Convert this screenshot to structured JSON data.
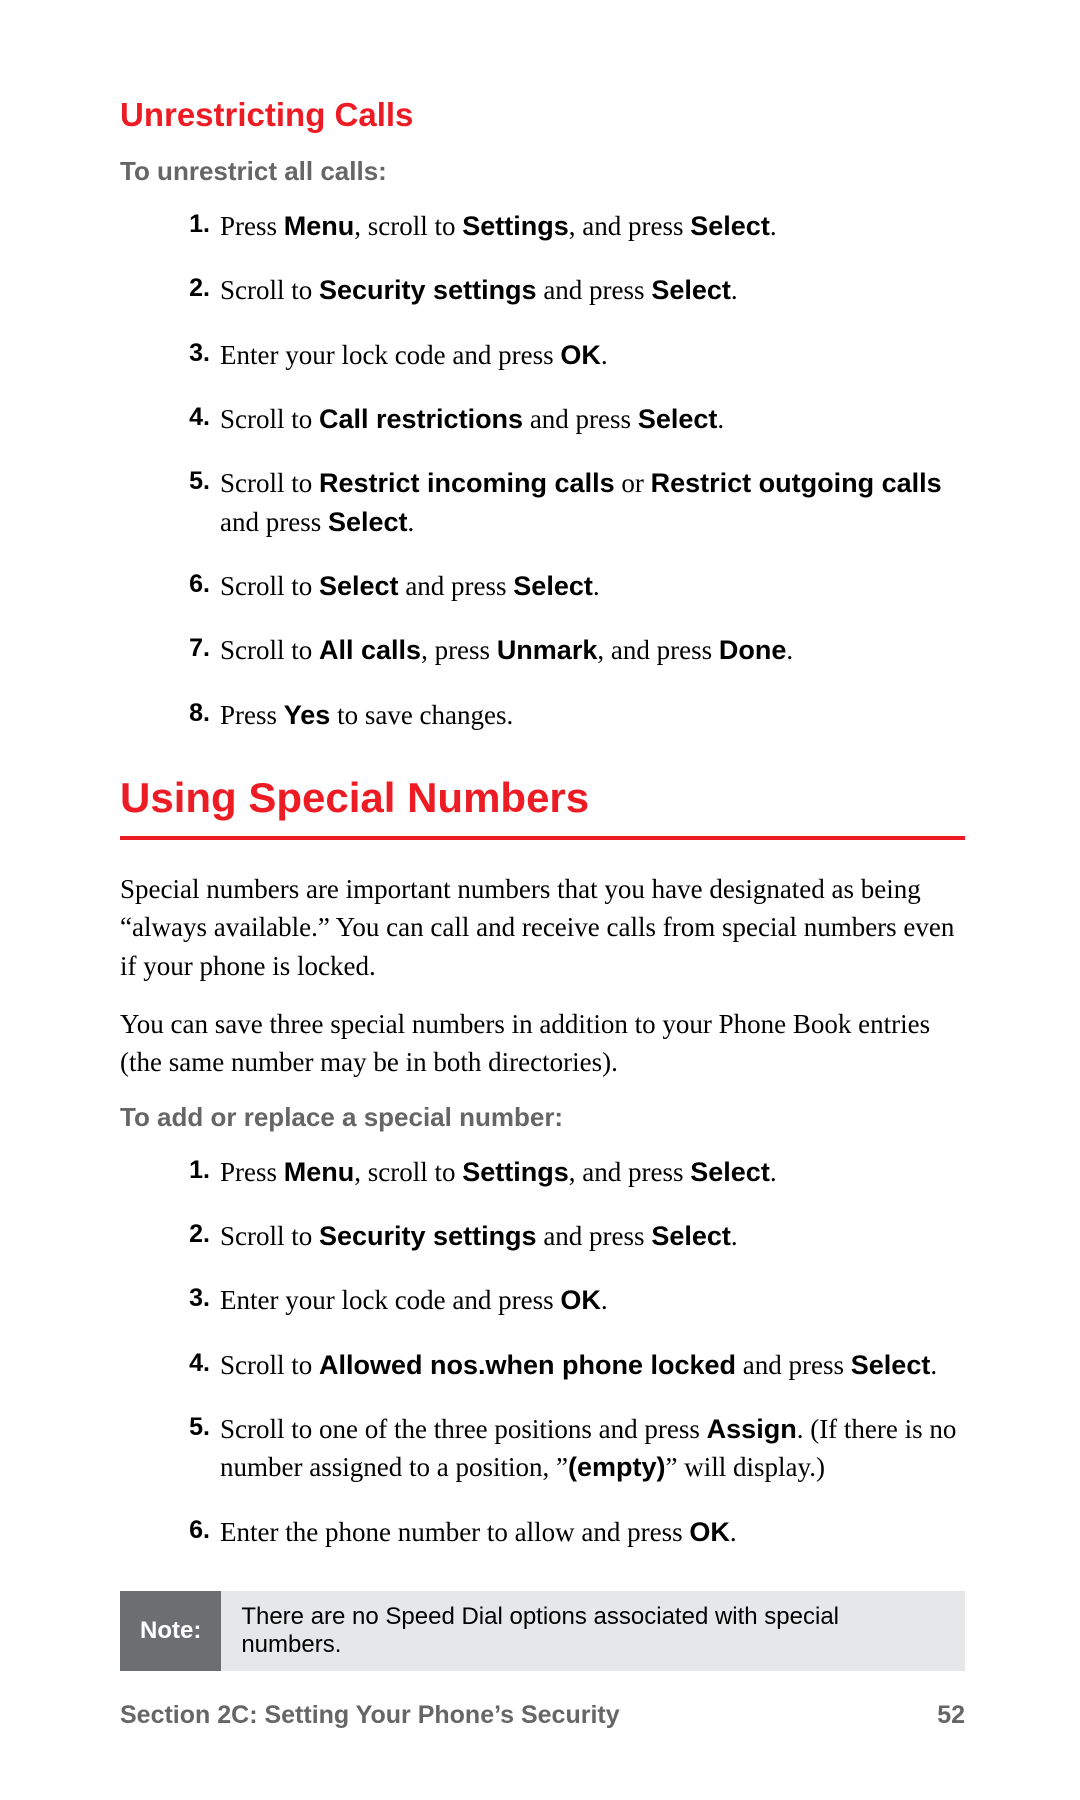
{
  "headings": {
    "unrestricting": "Unrestricting Calls",
    "using_special": "Using Special Numbers"
  },
  "leads": {
    "unrestrict_all": "To unrestrict all calls:",
    "add_special": "To add or replace a special number:"
  },
  "steps_unrestrict": [
    {
      "pre": "Press ",
      "b1": "Menu",
      "mid1": ", scroll to ",
      "b2": "Settings",
      "mid2": ", and press ",
      "b3": "Select",
      "post": "."
    },
    {
      "pre": "Scroll to ",
      "b1": "Security settings",
      "mid1": " and press ",
      "b2": "Select",
      "post": "."
    },
    {
      "pre": "Enter your lock code and press ",
      "b1": "OK",
      "post": "."
    },
    {
      "pre": "Scroll to ",
      "b1": "Call restrictions",
      "mid1": " and press ",
      "b2": "Select",
      "post": "."
    },
    {
      "pre": "Scroll to ",
      "b1": "Restrict incoming calls",
      "mid1": " or ",
      "b2": "Restrict outgoing calls",
      "mid2": " and press ",
      "b3": "Select",
      "post": "."
    },
    {
      "pre": "Scroll to ",
      "b1": "Select",
      "mid1": " and press ",
      "b2": "Select",
      "post": "."
    },
    {
      "pre": "Scroll to ",
      "b1": "All calls",
      "mid1": ", press ",
      "b2": "Unmark",
      "mid2": ", and press ",
      "b3": "Done",
      "post": "."
    },
    {
      "pre": "Press ",
      "b1": "Yes",
      "post": " to save changes."
    }
  ],
  "special_intro1": "Special numbers are important numbers that you have designated as being “always available.” You can call and receive calls from special numbers even if your phone is locked.",
  "special_intro2": "You can save three special numbers in addition to your Phone Book entries (the same number may be in both directories).",
  "steps_special": [
    {
      "pre": "Press ",
      "b1": "Menu",
      "mid1": ", scroll to ",
      "b2": "Settings",
      "mid2": ", and press ",
      "b3": "Select",
      "post": "."
    },
    {
      "pre": "Scroll to ",
      "b1": "Security settings",
      "mid1": " and press ",
      "b2": "Select",
      "post": "."
    },
    {
      "pre": "Enter your lock code and press ",
      "b1": "OK",
      "post": "."
    },
    {
      "pre": "Scroll to ",
      "b1": "Allowed nos.when phone locked",
      "mid1": " and press ",
      "b2": "Select",
      "post": "."
    },
    {
      "pre": "Scroll to one of the three positions and press ",
      "b1": "Assign",
      "mid1": ". (If there is no number assigned to a position, ”",
      "b2": "(empty)",
      "mid2": "” will display.)"
    },
    {
      "pre": "Enter the phone number to allow and press ",
      "b1": "OK",
      "post": "."
    }
  ],
  "note": {
    "label": "Note:",
    "body": "There are no Speed Dial options associated with special numbers."
  },
  "footer": {
    "section": "Section 2C: Setting Your Phone’s Security",
    "page": "52"
  }
}
